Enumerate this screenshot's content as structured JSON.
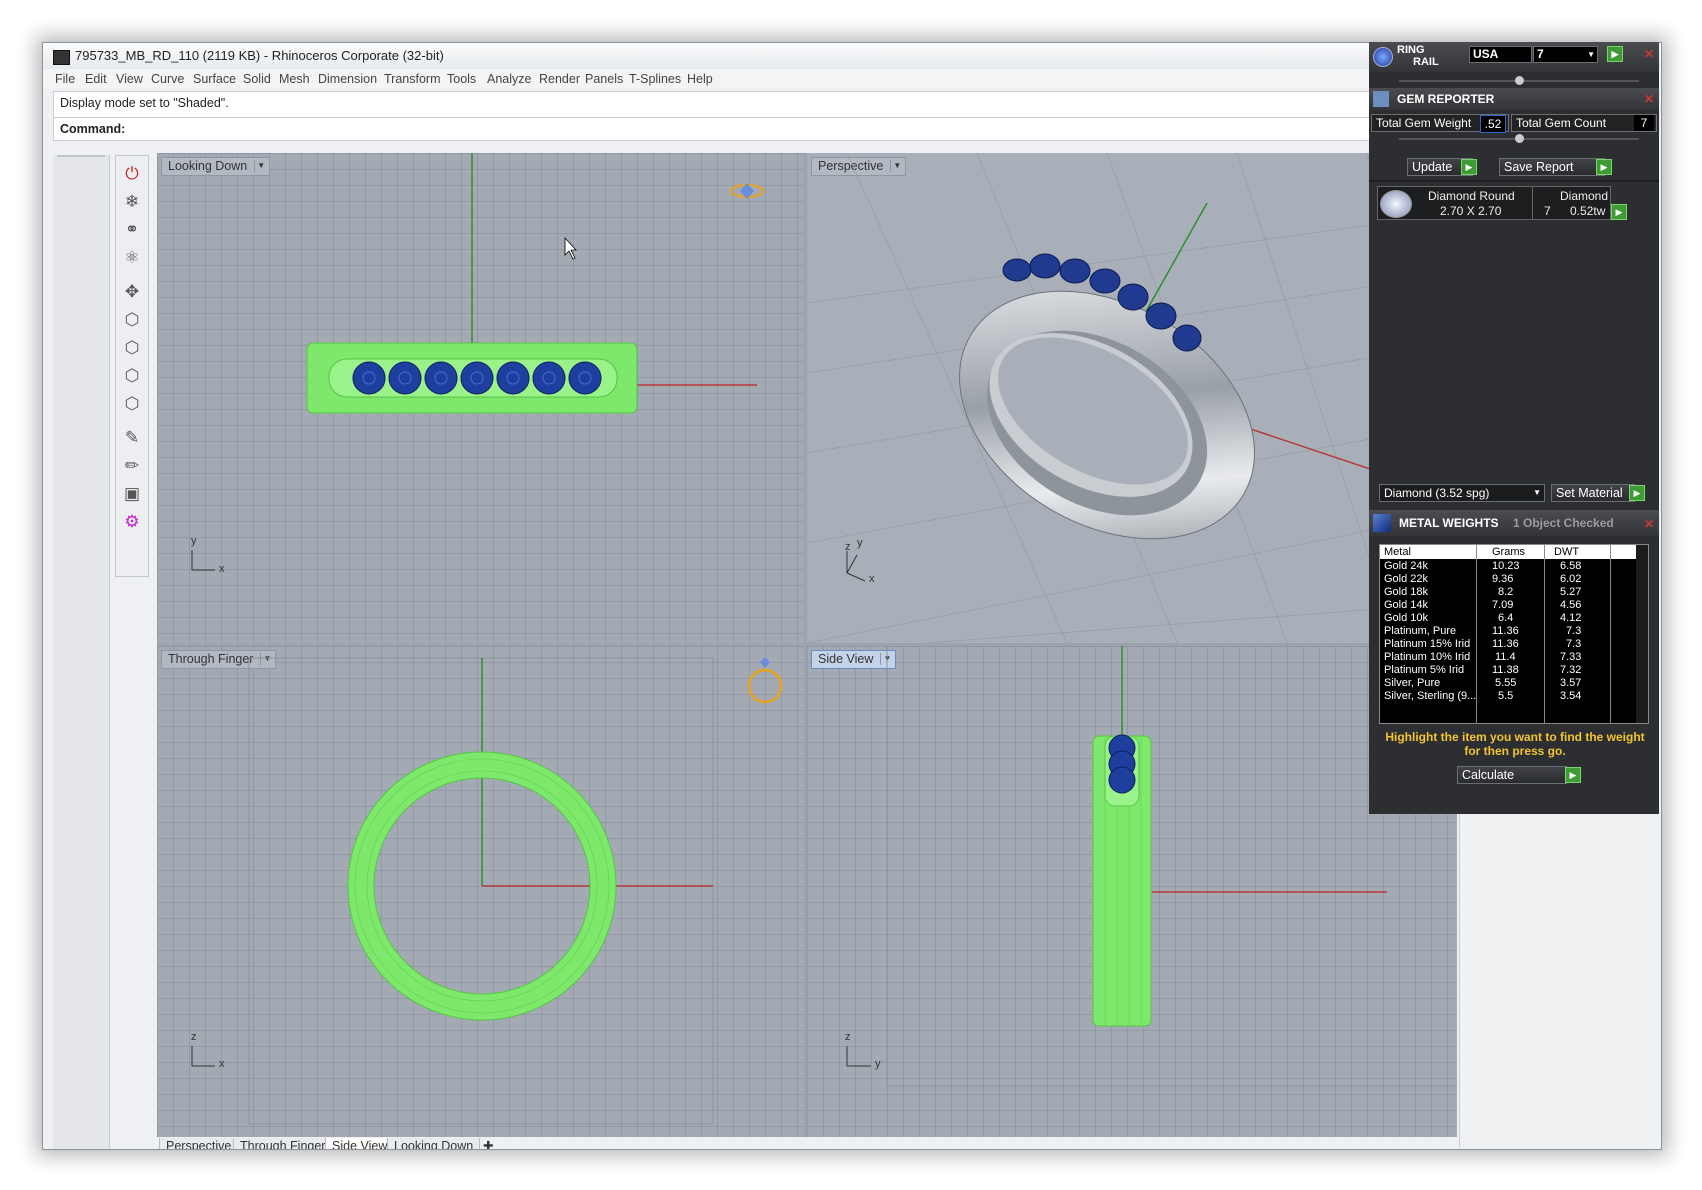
{
  "window": {
    "title": "795733_MB_RD_110 (2119 KB) - Rhinoceros Corporate (32-bit)"
  },
  "menu": [
    "File",
    "Edit",
    "View",
    "Curve",
    "Surface",
    "Solid",
    "Mesh",
    "Dimension",
    "Transform",
    "Tools",
    "Analyze",
    "Render",
    "Panels",
    "T-Splines",
    "Help"
  ],
  "command": {
    "history": "Display mode set to \"Shaded\".",
    "prompt": "Command:"
  },
  "viewports": {
    "top_left": {
      "label": "Looking Down",
      "axis_a": "y",
      "axis_b": "x"
    },
    "top_right": {
      "label": "Perspective",
      "axis_a": "z",
      "axis_b": "y",
      "axis_c": "x"
    },
    "bottom_left": {
      "label": "Through Finger",
      "axis_a": "z",
      "axis_b": "x"
    },
    "bottom_right": {
      "label": "Side View",
      "axis_a": "z",
      "axis_b": "y"
    }
  },
  "bottom_tabs": [
    "Perspective",
    "Through Finger",
    "Side View",
    "Looking Down"
  ],
  "bottom_tabs_active": "Side View",
  "plugin": {
    "ring_rail": {
      "title_a": "RING",
      "title_b": "RAIL",
      "region": "USA",
      "size": "7"
    },
    "gem_reporter": {
      "title": "GEM REPORTER",
      "total_weight_label": "Total Gem Weight",
      "total_weight": ".52",
      "total_count_label": "Total Gem Count",
      "total_count": "7",
      "update_label": "Update",
      "save_label": "Save Report",
      "gem": {
        "shape": "Diamond Round",
        "size": "2.70 X 2.70",
        "material": "Diamond",
        "count": "7",
        "weight": "0.52tw"
      },
      "material_select": "Diamond    (3.52 spg)",
      "set_material_label": "Set Material"
    },
    "metal_weights": {
      "title": "METAL WEIGHTS",
      "status": "1 Object Checked",
      "columns": [
        "Metal",
        "Grams",
        "DWT"
      ],
      "rows": [
        [
          "Gold 24k",
          "10.23",
          "6.58"
        ],
        [
          "Gold 22k",
          "9.36",
          "6.02"
        ],
        [
          "Gold 18k",
          "8.2",
          "5.27"
        ],
        [
          "Gold 14k",
          "7.09",
          "4.56"
        ],
        [
          "Gold 10k",
          "6.4",
          "4.12"
        ],
        [
          "Platinum, Pure",
          "11.36",
          "7.3"
        ],
        [
          "Platinum 15% Irid",
          "11.36",
          "7.3"
        ],
        [
          "Platinum 10% Irid",
          "11.4",
          "7.33"
        ],
        [
          "Platinum 5% Irid",
          "11.38",
          "7.32"
        ],
        [
          "Silver, Pure",
          "5.55",
          "3.57"
        ],
        [
          "Silver, Sterling (9...",
          "5.5",
          "3.54"
        ]
      ],
      "hint": "Highlight the item you want to find the weight for then press go.",
      "calculate_label": "Calculate"
    }
  },
  "colors": {
    "viewport_bg": "#a3aab4",
    "wire_green": "#7de86b",
    "gem_blue": "#1f3f9e",
    "panel_bg": "#2d2e31",
    "hint_text": "#f2c431"
  }
}
